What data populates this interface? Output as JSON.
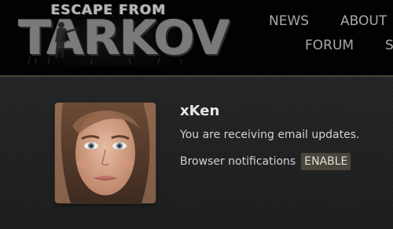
{
  "header": {
    "logo": {
      "top_text": "ESCAPE FROM",
      "main_text": "TARKOV"
    },
    "nav": {
      "news": "NEWS",
      "about": "ABOUT",
      "forum": "FORUM",
      "partial": "S"
    }
  },
  "profile": {
    "username": "xKen",
    "email_status": "You are receiving email updates.",
    "notifications_label": "Browser notifications",
    "enable_button": "ENABLE"
  },
  "colors": {
    "header_bg": "#020202",
    "panel_bg": "#1d1e1f",
    "panel_border": "#4b443a",
    "nav_text": "#a8a8a8",
    "button_bg": "#4a453a"
  }
}
